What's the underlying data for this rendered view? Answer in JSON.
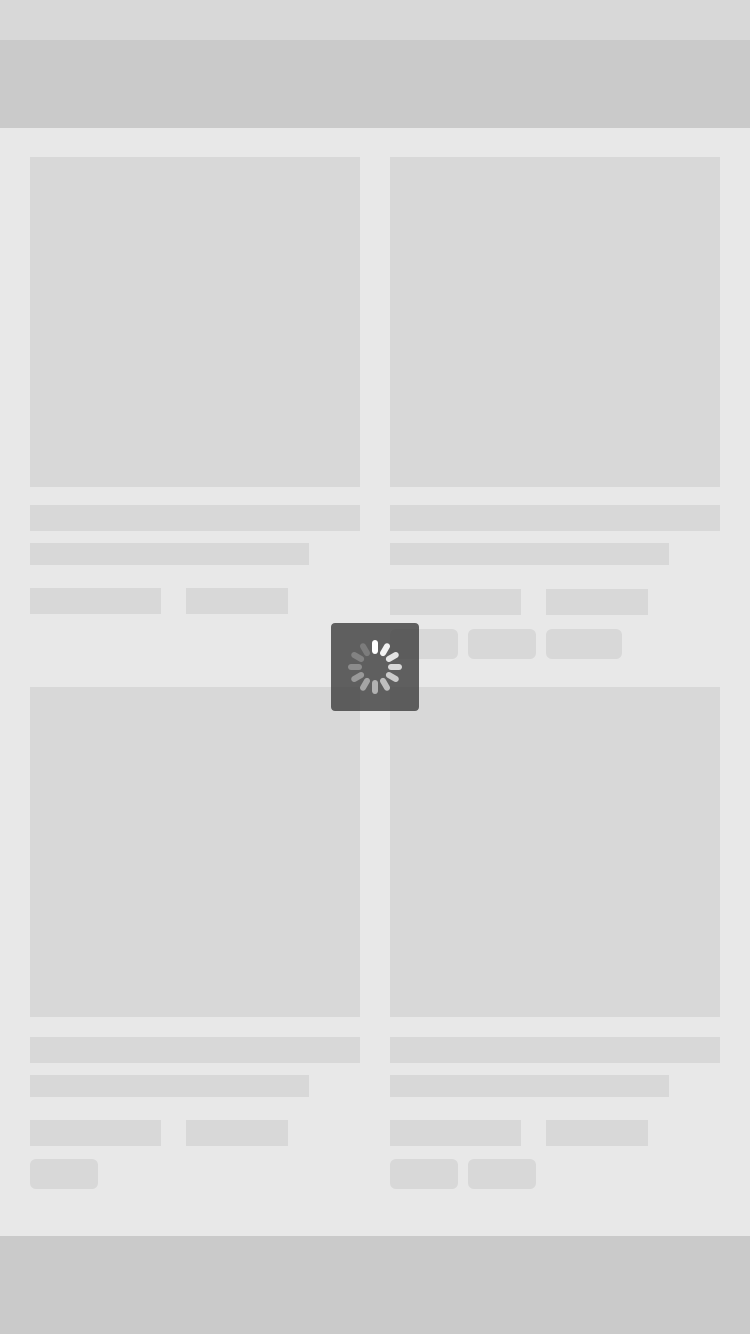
{
  "screen": {
    "state": "loading",
    "placeholder_cards": [
      {
        "name": "card-1",
        "tags": 0
      },
      {
        "name": "card-2",
        "tags": 3
      },
      {
        "name": "card-3",
        "tags": 1
      },
      {
        "name": "card-4",
        "tags": 2
      }
    ]
  },
  "icons": {
    "loading": "spinner-icon"
  },
  "colors": {
    "background": "#e8e8e8",
    "skeleton": "#d8d8d8",
    "bars": "#cacaca",
    "hud": "#464646"
  }
}
